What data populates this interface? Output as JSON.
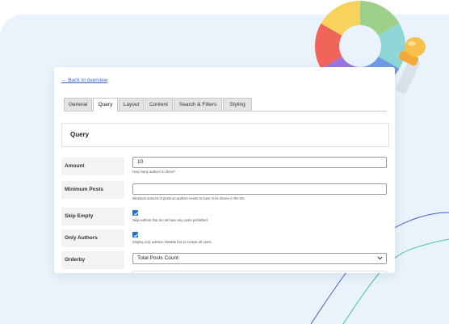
{
  "back_link": "← Back to overview",
  "tabs": [
    {
      "label": "General"
    },
    {
      "label": "Query"
    },
    {
      "label": "Layout"
    },
    {
      "label": "Content"
    },
    {
      "label": "Search & Filters"
    },
    {
      "label": "Styling"
    }
  ],
  "active_tab": "Query",
  "section_title": "Query",
  "fields": {
    "amount": {
      "label": "Amount",
      "value": "10",
      "help": "How many authors to show?"
    },
    "min_posts": {
      "label": "Minimum Posts",
      "value": "",
      "help": "Minimum amount of posts an authors needs to have to be shown in the list."
    },
    "skip_empty": {
      "label": "Skip Empty",
      "checked": true,
      "help": "Skip authors that do not have any posts published."
    },
    "only_authors": {
      "label": "Only Authors",
      "checked": true,
      "help": "Display only authors. Disable this to include all users."
    },
    "orderby": {
      "label": "Orderby",
      "value": "Total Posts Count"
    }
  },
  "colors": {
    "accent": "#2d6fbd",
    "background": "#eaf3fc"
  },
  "icons": [
    "color-wheel-icon",
    "eyedropper-icon",
    "checkmark-icon",
    "chevron-down-icon"
  ]
}
